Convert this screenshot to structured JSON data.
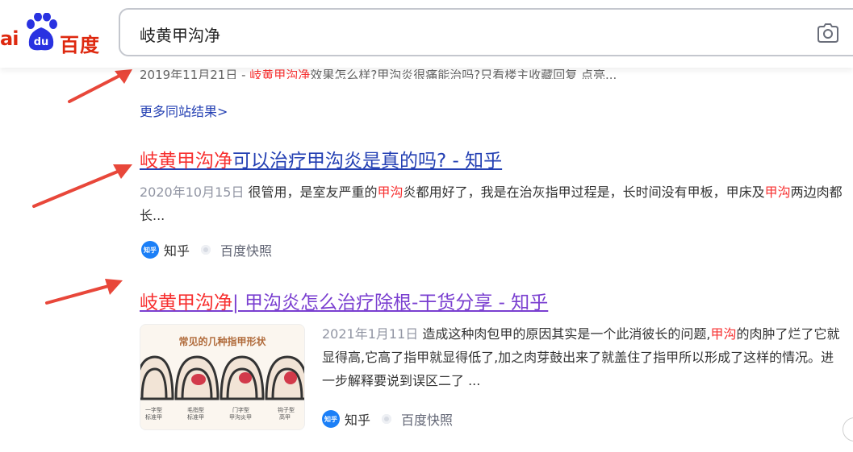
{
  "header": {
    "logo_left_text": "ai",
    "logo_cn_text": "百度",
    "logo_paw_text": "du",
    "search_value": "岐黄甲沟净",
    "camera_icon": "camera-icon"
  },
  "partial_result": {
    "date": "2019年11月21日 - ",
    "red": "岐黄甲沟净",
    "rest": "效果怎么样?甲沟炎很痛能治吗?只看楼主收藏回复 点亮..."
  },
  "more_link": "更多同站结果>",
  "results": [
    {
      "title_highlight": "岐黄甲沟净",
      "title_rest": "可以治疗甲沟炎是真的吗? - 知乎",
      "date": "2020年10月15日",
      "snippet_parts": [
        " 很管用，是室友严重的",
        "甲沟",
        "炎都用好了，我是在治灰指甲过程是，长时间没有甲板，甲床及",
        "甲沟",
        "两边肉都长..."
      ],
      "source": "知乎",
      "snapshot": "百度快照"
    },
    {
      "title_highlight": "岐黄甲沟净",
      "title_rest": "| 甲沟炎怎么治疗除根-干货分享 - 知乎",
      "date": "2021年1月11日",
      "snippet_parts": [
        " 造成这种肉包甲的原因其实是一个此消彼长的问题,",
        "甲沟",
        "的肉肿了烂了它就显得高,它高了指甲就显得低了,加之肉芽鼓出来了就盖住了指甲所以形成了这样的情况。进一步解释要说到误区二了 ..."
      ],
      "source": "知乎",
      "snapshot": "百度快照",
      "thumb_title": "常见的几种指甲形状",
      "thumb_labels": [
        "一字型\n标准甲",
        "毛指型\n标准甲",
        "门字型\n甲沟炎甲",
        "钩子型\n高甲"
      ]
    }
  ],
  "colors": {
    "link": "#2440b3",
    "visited": "#7a3fd0",
    "highlight": "#f73131",
    "arrow": "#e8473a"
  }
}
